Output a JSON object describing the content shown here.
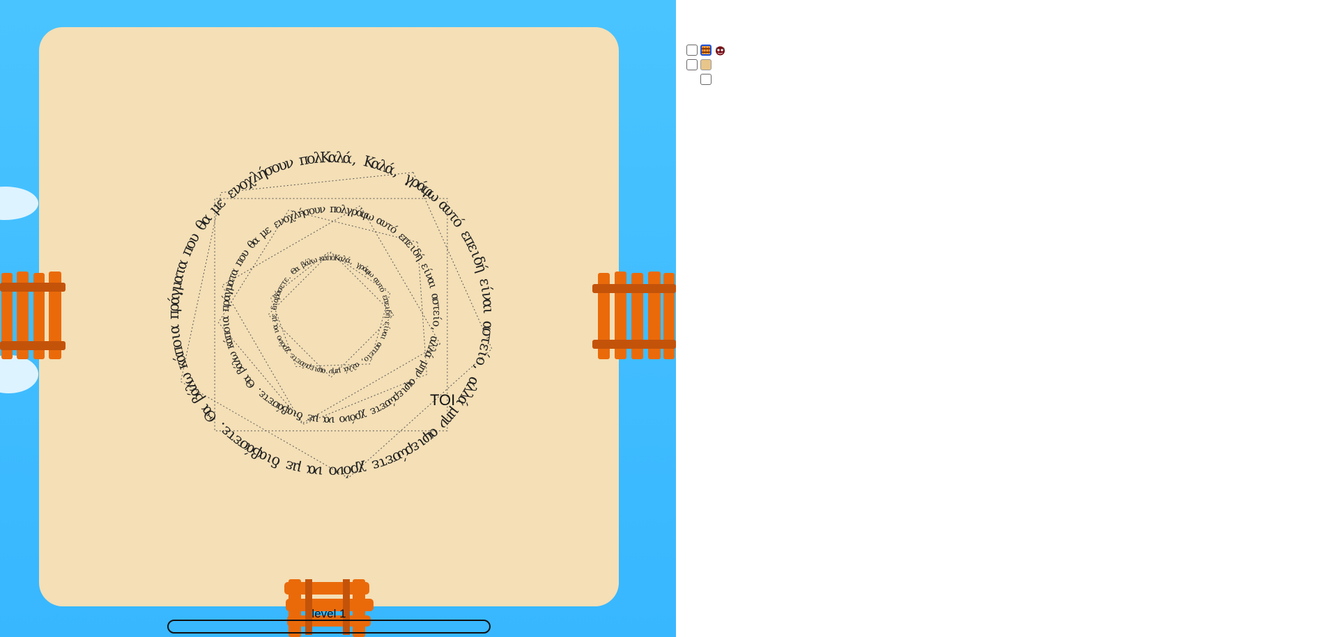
{
  "game": {
    "spiral_text": "Καλά, γράφω αυτό επειδή είναι αστείο, αλλά μην αφιερώσετε χρόνο να με διαβάσετε. Θα βάλω κάποια πράγματα που θα με ενοχλήσουν πολ",
    "floating_word": "TOI",
    "level_label": "level 1",
    "level_progress": 0
  },
  "colors": {
    "sky": "#3ab9ff",
    "board": "#f4dfb6",
    "fence": "#ea6a0a",
    "fence_dark": "#c4530a",
    "text": "#222222"
  },
  "toolbar": {
    "icons": [
      "empty-slot-icon",
      "bridge-tile-icon",
      "monster-icon",
      "empty-slot-icon",
      "board-tile-icon",
      "empty-slot-icon"
    ]
  }
}
